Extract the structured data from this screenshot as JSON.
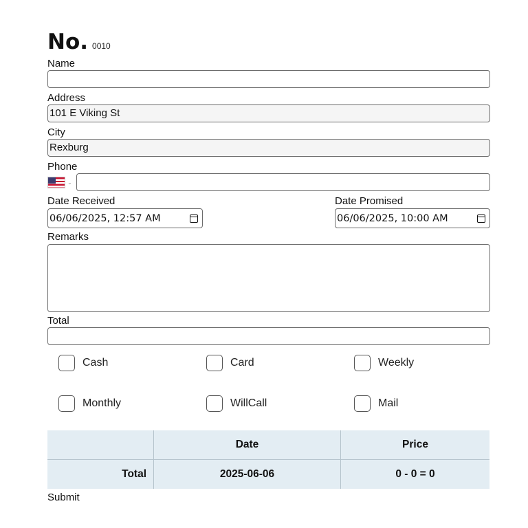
{
  "header": {
    "title": "No.",
    "number": "0010"
  },
  "form": {
    "name_label": "Name",
    "name_value": "",
    "address_label": "Address",
    "address_value": "101 E Viking St",
    "city_label": "City",
    "city_value": "Rexburg",
    "phone_label": "Phone",
    "phone_country_icon": "us-flag-icon",
    "phone_value": "",
    "date_received_label": "Date Received",
    "date_received_value": "06/06/2025, 12:57 AM",
    "date_promised_label": "Date Promised",
    "date_promised_value": "06/06/2025, 10:00 AM",
    "remarks_label": "Remarks",
    "remarks_value": "",
    "total_label": "Total",
    "total_value": ""
  },
  "payment_options": [
    {
      "label": "Cash",
      "checked": false
    },
    {
      "label": "Card",
      "checked": false
    },
    {
      "label": "Weekly",
      "checked": false
    },
    {
      "label": "Monthly",
      "checked": false
    },
    {
      "label": "WillCall",
      "checked": false
    },
    {
      "label": "Mail",
      "checked": false
    }
  ],
  "summary_table": {
    "headers": [
      "",
      "Date",
      "Price"
    ],
    "rows": [
      {
        "label": "Total",
        "date": "2025-06-06",
        "price": "0 - 0 = 0"
      }
    ]
  },
  "submit_label": "Submit",
  "colors": {
    "table_bg": "#e3edf3",
    "border": "#6b6b6b",
    "flag_red": "#c8102e",
    "flag_blue": "#3c3b6e"
  }
}
